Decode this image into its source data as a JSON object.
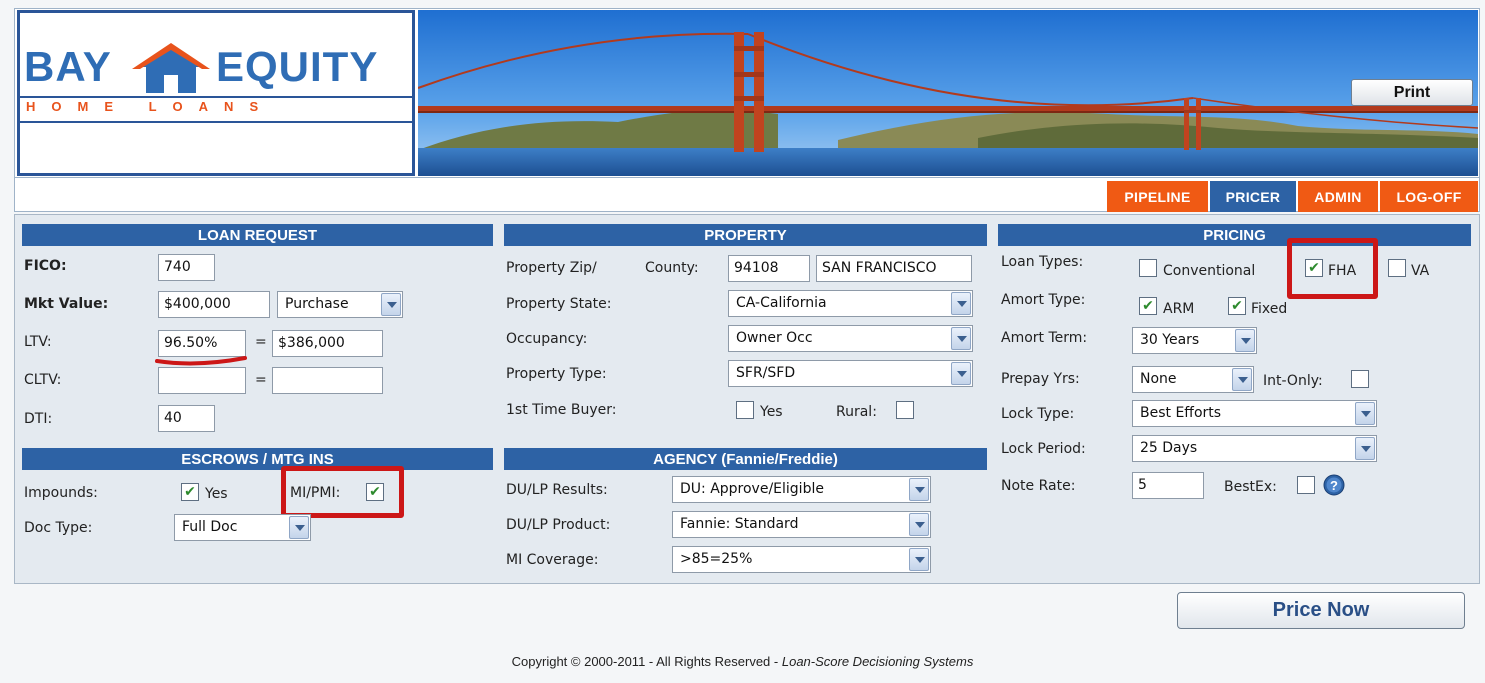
{
  "logo": {
    "line1_left": "BAY",
    "line1_right": "EQUITY",
    "line2": "HOME LOANS"
  },
  "header": {
    "print_label": "Print"
  },
  "colors": {
    "nav_orange": "#f05a14",
    "nav_active": "#2d62a5",
    "section_header": "#2d62a5",
    "highlight_red": "#cc1717",
    "check_green": "#2d8a2d"
  },
  "nav": {
    "tabs": [
      {
        "label": "PIPELINE"
      },
      {
        "label": "PRICER"
      },
      {
        "label": "ADMIN"
      },
      {
        "label": "LOG-OFF"
      }
    ],
    "active": "PRICER"
  },
  "loan_request": {
    "title": "LOAN REQUEST",
    "fico_label": "FICO:",
    "fico_value": "740",
    "mkt_label": "Mkt Value:",
    "mkt_value": "$400,000",
    "purpose": "Purchase",
    "ltv_label": "LTV:",
    "ltv_value": "96.50%",
    "eq": "=",
    "loan_amount": "$386,000",
    "cltv_label": "CLTV:",
    "cltv_value": "",
    "cltv_amount": "",
    "dti_label": "DTI:",
    "dti_value": "40"
  },
  "escrows": {
    "title": "ESCROWS / MTG INS",
    "impounds_label": "Impounds:",
    "impounds_checked": true,
    "impounds_yes": "Yes",
    "mi_label": "MI/PMI:",
    "mi_checked": true,
    "doc_type_label": "Doc Type:",
    "doc_type_value": "Full Doc"
  },
  "property": {
    "title": "PROPERTY",
    "zip_label": "Property Zip/",
    "county_label": "County:",
    "zip_value": "94108",
    "county_value": "SAN FRANCISCO",
    "state_label": "Property State:",
    "state_value": "CA-California",
    "occupancy_label": "Occupancy:",
    "occupancy_value": "Owner Occ",
    "type_label": "Property Type:",
    "type_value": "SFR/SFD",
    "first_time_label": "1st Time Buyer:",
    "first_time_yes": "Yes",
    "rural_label": "Rural:"
  },
  "agency": {
    "title": "AGENCY (Fannie/Freddie)",
    "results_label": "DU/LP Results:",
    "results_value": "DU: Approve/Eligible",
    "product_label": "DU/LP Product:",
    "product_value": "Fannie: Standard",
    "mi_coverage_label": "MI Coverage:",
    "mi_coverage_value": ">85=25%"
  },
  "pricing": {
    "title": "PRICING",
    "loan_types_label": "Loan Types:",
    "conventional": "Conventional",
    "fha": "FHA",
    "va": "VA",
    "amort_type_label": "Amort Type:",
    "arm": "ARM",
    "fixed": "Fixed",
    "amort_term_label": "Amort Term:",
    "amort_term_value": "30 Years",
    "prepay_label": "Prepay Yrs:",
    "prepay_value": "None",
    "int_only_label": "Int-Only:",
    "lock_type_label": "Lock Type:",
    "lock_type_value": "Best Efforts",
    "lock_period_label": "Lock Period:",
    "lock_period_value": "25 Days",
    "note_rate_label": "Note Rate:",
    "note_rate_value": "5",
    "bestex_label": "BestEx:"
  },
  "actions": {
    "price_now": "Price Now"
  },
  "footer": {
    "copyright": "Copyright © 2000-2011 - All Rights Reserved  - ",
    "company": "Loan-Score Decisioning Systems"
  }
}
